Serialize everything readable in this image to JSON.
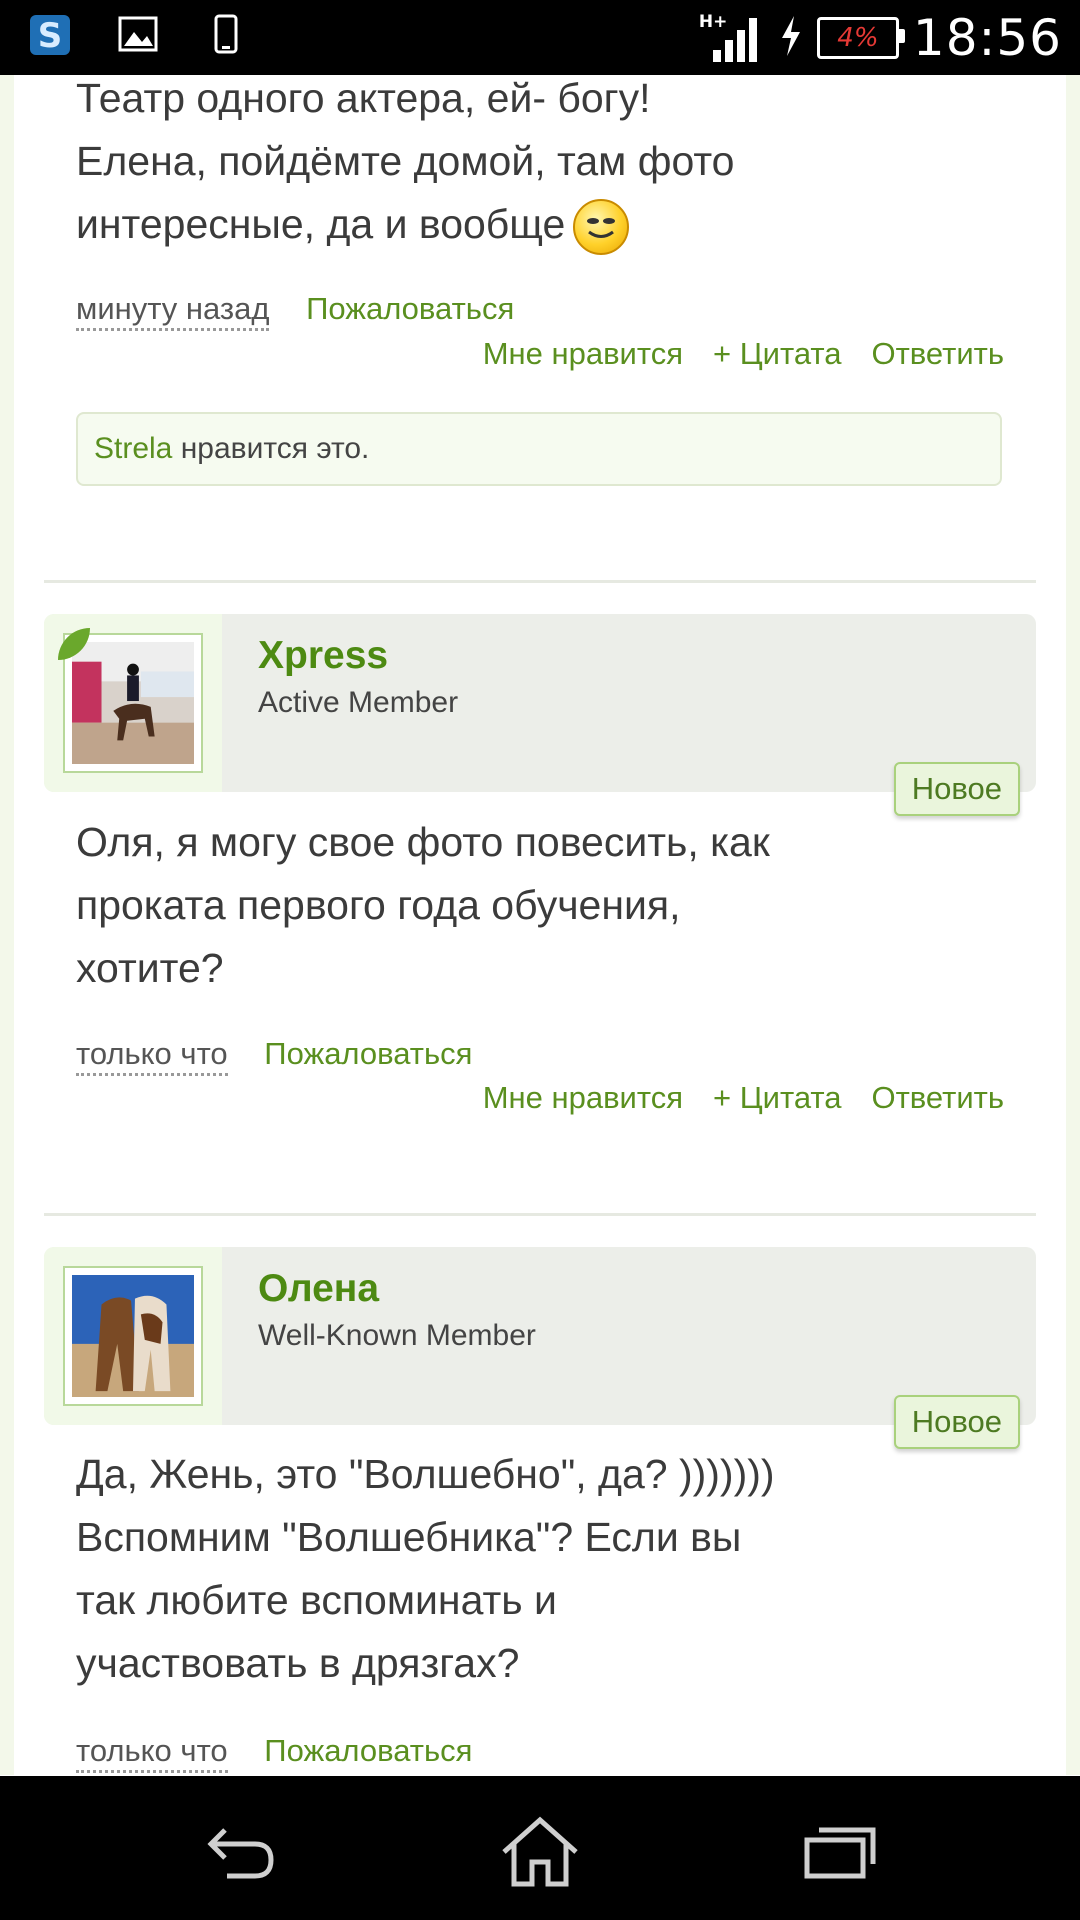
{
  "status_bar": {
    "icons": [
      "s-app-icon",
      "gallery-icon",
      "phone-icon"
    ],
    "network": "H+",
    "battery": "4%",
    "time": "18:56"
  },
  "posts": [
    {
      "lines": [
        "Театр одного актера, ей- богу!",
        "Елена, пойдёмте домой, там фото",
        "интересные, да и вообще"
      ],
      "time": "минуту назад",
      "report": "Пожаловаться",
      "like": "Мне нравится",
      "quote": "+ Цитата",
      "reply": "Ответить",
      "likes_user": "Strela",
      "likes_text": " нравится это."
    },
    {
      "username": "Xpress",
      "usertitle": "Active Member",
      "badge": "Новое",
      "lines": [
        "Оля, я могу свое фото повесить, как",
        "проката первого года обучения,",
        "хотите?"
      ],
      "time": "только что",
      "report": "Пожаловаться",
      "like": "Мне нравится",
      "quote": "+ Цитата",
      "reply": "Ответить"
    },
    {
      "username": "Олена",
      "usertitle": "Well-Known Member",
      "badge": "Новое",
      "lines": [
        "Да, Жень, это \"Волшебно\", да? )))))))",
        "Вспомним \"Волшебника\"? Если вы",
        "так любите вспоминать и",
        "участвовать в дрязгах?"
      ],
      "time": "только что",
      "report": "Пожаловаться"
    }
  ]
}
